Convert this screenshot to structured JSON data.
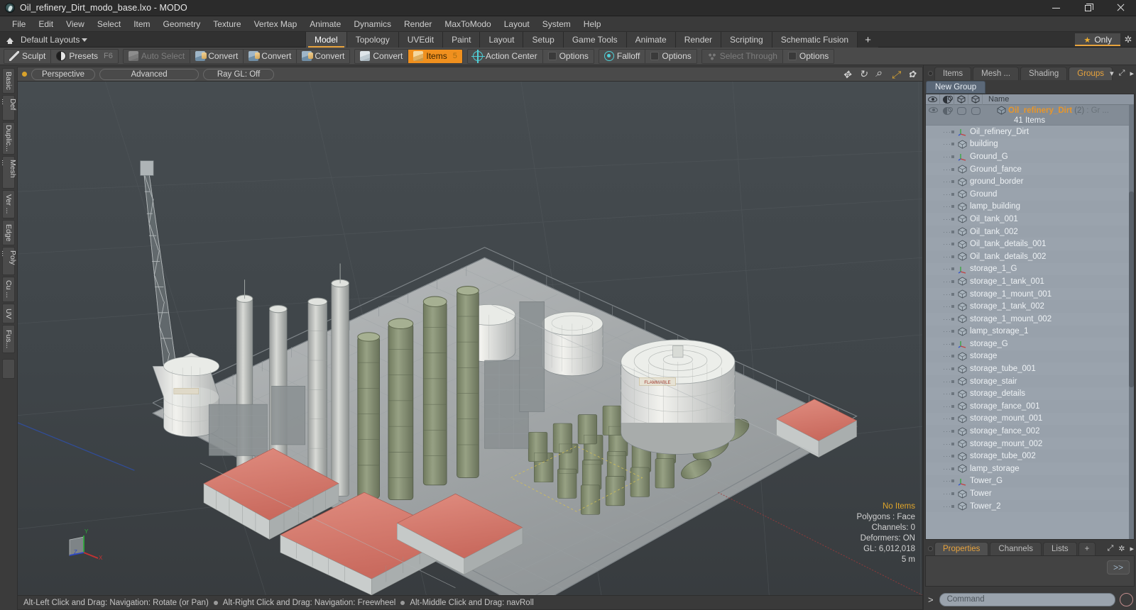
{
  "window": {
    "title": "Oil_refinery_Dirt_modo_base.lxo - MODO",
    "app_icon": "modo-logo-icon",
    "minimize": "minimize-icon",
    "maximize": "maximize-icon",
    "close": "close-icon"
  },
  "menubar": {
    "items": [
      "File",
      "Edit",
      "View",
      "Select",
      "Item",
      "Geometry",
      "Texture",
      "Vertex Map",
      "Animate",
      "Dynamics",
      "Render",
      "MaxToModo",
      "Layout",
      "System",
      "Help"
    ]
  },
  "layoutbar": {
    "default_layouts": "Default Layouts",
    "tabs": [
      "Model",
      "Topology",
      "UVEdit",
      "Paint",
      "Layout",
      "Setup",
      "Game Tools",
      "Animate",
      "Render",
      "Scripting",
      "Schematic Fusion"
    ],
    "active_tab": "Model",
    "add_tab": "+",
    "only_label": "Only",
    "star_icon": "star-icon",
    "gear_icon": "gear-icon"
  },
  "modebar": {
    "group1": [
      {
        "label": "Sculpt",
        "icon": "sculpt-icon",
        "state": "normal",
        "fkey": ""
      },
      {
        "label": "Presets",
        "icon": "presets-icon",
        "state": "normal",
        "fkey": "F6"
      }
    ],
    "group2": [
      {
        "label": "Auto Select",
        "icon": "autoselect-icon",
        "state": "dim",
        "fkey": ""
      },
      {
        "label": "Convert",
        "icon": "convert-vertex-icon",
        "state": "normal",
        "fkey": ""
      },
      {
        "label": "Convert",
        "icon": "convert-edge-icon",
        "state": "normal",
        "fkey": ""
      },
      {
        "label": "Convert",
        "icon": "convert-polygon-icon",
        "state": "normal",
        "fkey": ""
      }
    ],
    "group3": [
      {
        "label": "Convert",
        "icon": "convert-item-icon",
        "state": "normal",
        "fkey": ""
      },
      {
        "label": "Items",
        "icon": "items-cube-icon",
        "state": "active",
        "fkey": "5"
      }
    ],
    "group4": [
      {
        "label": "Action Center",
        "icon": "action-center-icon",
        "state": "normal",
        "fkey": ""
      },
      {
        "label": "Options",
        "icon": "options-icon",
        "state": "normal",
        "fkey": ""
      }
    ],
    "group5": [
      {
        "label": "Falloff",
        "icon": "falloff-icon",
        "state": "normal",
        "fkey": ""
      },
      {
        "label": "Options",
        "icon": "options-icon",
        "state": "normal",
        "fkey": ""
      }
    ],
    "group6": [
      {
        "label": "Select Through",
        "icon": "select-through-icon",
        "state": "dim",
        "fkey": ""
      },
      {
        "label": "Options",
        "icon": "options-icon",
        "state": "normal",
        "fkey": ""
      }
    ]
  },
  "left_tabs": [
    "Basic",
    "Def ...",
    "Duplic...",
    "Mesh ...",
    "Ver ...",
    "Edge",
    "Poly ...",
    "Cu ...",
    "UV",
    "Fus..."
  ],
  "viewport": {
    "header": {
      "view_mode": "Perspective",
      "shading": "Advanced",
      "raygl": "Ray GL: Off",
      "icons": [
        "pan-icon",
        "rotate-icon",
        "zoom-icon",
        "expand-icon",
        "gear-icon"
      ]
    },
    "info": {
      "no_items": "No Items",
      "polygons": "Polygons : Face",
      "channels": "Channels: 0",
      "deformers": "Deformers: ON",
      "gl": "GL: 6,012,018",
      "grid": "5 m"
    },
    "axis": {
      "x": "X",
      "y": "Y",
      "z": "Z"
    },
    "scene_description": "Oil refinery 3D model with wireframe overlay, storage tanks, distillation towers, red-roofed buildings and ground plane"
  },
  "statusbar": {
    "hints": [
      "Alt-Left Click and Drag: Navigation: Rotate (or Pan)",
      "Alt-Right Click and Drag: Navigation: Freewheel",
      "Alt-Middle Click and Drag: navRoll"
    ]
  },
  "right_panel": {
    "tabs": [
      "Items",
      "Mesh ...",
      "Shading",
      "Groups"
    ],
    "active_tab": "Groups",
    "tab_icons": [
      "chevron-down-icon",
      "expand-icon",
      "chevron-right-icon"
    ],
    "new_group_button": "New Group",
    "tree_header": {
      "col_visible": "visibility-icon",
      "col_shading": "shading-icon",
      "col_render": "render-icon",
      "col_wireframe": "wireframe-icon",
      "name": "Name"
    },
    "group": {
      "name": "Oil_refinery_Dirt",
      "count": "(2)",
      "type": ": Gr",
      "ellipsis": "...",
      "items_label": "41 Items"
    },
    "items": [
      {
        "name": "Oil_refinery_Dirt",
        "type": "locator"
      },
      {
        "name": "building",
        "type": "mesh"
      },
      {
        "name": "Ground_G",
        "type": "locator"
      },
      {
        "name": "Ground_fance",
        "type": "mesh"
      },
      {
        "name": "ground_border",
        "type": "mesh"
      },
      {
        "name": "Ground",
        "type": "mesh"
      },
      {
        "name": "lamp_building",
        "type": "mesh"
      },
      {
        "name": "Oil_tank_001",
        "type": "mesh"
      },
      {
        "name": "Oil_tank_002",
        "type": "mesh"
      },
      {
        "name": "Oil_tank_details_001",
        "type": "mesh"
      },
      {
        "name": "Oil_tank_details_002",
        "type": "mesh"
      },
      {
        "name": "storage_1_G",
        "type": "locator"
      },
      {
        "name": "storage_1_tank_001",
        "type": "mesh"
      },
      {
        "name": "storage_1_mount_001",
        "type": "mesh"
      },
      {
        "name": "storage_1_tank_002",
        "type": "mesh"
      },
      {
        "name": "storage_1_mount_002",
        "type": "mesh"
      },
      {
        "name": "lamp_storage_1",
        "type": "mesh"
      },
      {
        "name": "storage_G",
        "type": "locator"
      },
      {
        "name": "storage",
        "type": "mesh"
      },
      {
        "name": "storage_tube_001",
        "type": "mesh"
      },
      {
        "name": "storage_stair",
        "type": "mesh"
      },
      {
        "name": "storage_details",
        "type": "mesh"
      },
      {
        "name": "storage_fance_001",
        "type": "mesh"
      },
      {
        "name": "storage_mount_001",
        "type": "mesh"
      },
      {
        "name": "storage_fance_002",
        "type": "mesh"
      },
      {
        "name": "storage_mount_002",
        "type": "mesh"
      },
      {
        "name": "storage_tube_002",
        "type": "mesh"
      },
      {
        "name": "lamp_storage",
        "type": "mesh"
      },
      {
        "name": "Tower_G",
        "type": "locator"
      },
      {
        "name": "Tower",
        "type": "mesh"
      },
      {
        "name": "Tower_2",
        "type": "mesh"
      }
    ],
    "bottom_tabs": [
      "Properties",
      "Channels",
      "Lists"
    ],
    "bottom_active_tab": "Properties",
    "bottom_add": "+",
    "props_expand": ">>",
    "command": {
      "prompt": ">",
      "placeholder": "Command",
      "record_icon": "record-icon"
    }
  },
  "colors": {
    "accent_orange": "#e8a33d",
    "tree_bg": "#9aa3ad",
    "panel_bg": "#3b3b3b",
    "viewport_bg": "#3f4447",
    "roof_red": "#d4766a"
  }
}
